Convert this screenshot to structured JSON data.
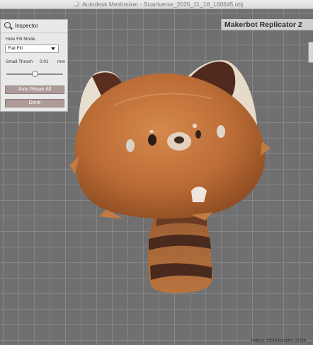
{
  "window": {
    "title": "Autodesk Meshmixer - Scaniverse_2025_11_18_160645.obj"
  },
  "printer": {
    "label": "Makerbot Replicator 2"
  },
  "inspector": {
    "title": "Inspector",
    "hole_fill_mode_label": "Hole Fill Mode",
    "hole_fill_mode_value": "Flat Fill",
    "small_thresh_label": "Small Thresh",
    "small_thresh_value": "0.01",
    "small_thresh_unit": "mm",
    "small_thresh_slider_fraction": 0.5,
    "auto_repair_label": "Auto Repair All",
    "done_label": "Done"
  },
  "status": {
    "stats": "vertices: 10614 triangles: 21524"
  },
  "colors": {
    "button": "#ae9a99",
    "viewport": "#707070",
    "fur": "#c0713a"
  },
  "icons": [
    "app-icon",
    "search-icon",
    "chevron-down-icon"
  ]
}
